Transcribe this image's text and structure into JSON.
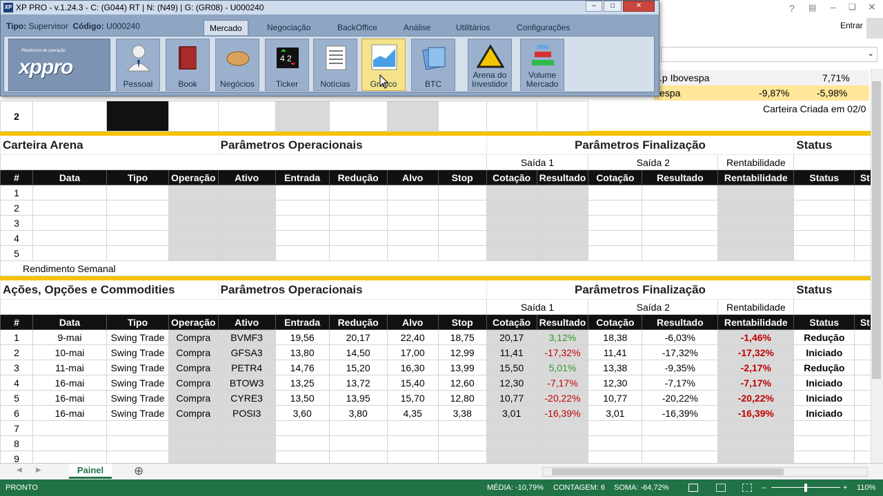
{
  "excel": {
    "signin": "Entrar",
    "sheet_tab": "Painel",
    "add_sheet": "⊕"
  },
  "window": {
    "title": "XP PRO  - v.1.24.3 - C: (G044) RT | N: (N49) | G: (GR08) - U000240",
    "tipo_label": "Tipo:",
    "tipo_value": "Supervisor",
    "codigo_label": "Código:",
    "codigo_value": "U000240",
    "min": "–",
    "max": "□",
    "close": "✕",
    "tabs": [
      "Mercado",
      "Negociação",
      "BackOffice",
      "Análise",
      "Utilitários",
      "Configurações"
    ],
    "brand_tag": "Plataforma de operação",
    "brand_logo": "xppro",
    "buttons": [
      {
        "label": "Pessoal",
        "icon": "person-icon"
      },
      {
        "label": "Book",
        "icon": "book-icon"
      },
      {
        "label": "Negócios",
        "icon": "handshake-icon"
      },
      {
        "label": "Ticker",
        "icon": "ticker-icon"
      },
      {
        "label": "Notícias",
        "icon": "news-icon"
      },
      {
        "label": "Gráfico",
        "icon": "chart-icon"
      },
      {
        "label": "BTC",
        "icon": "btc-icon"
      },
      {
        "label": "Arena do Investidor",
        "icon": "arena-icon"
      },
      {
        "label": "Volume Mercado",
        "icon": "volume-icon"
      }
    ]
  },
  "overlay": {
    "ibov_label": ".p Ibovespa",
    "ibov_value": "7,71%",
    "ibov2_label": "espa",
    "ibov2_a": "-9,87%",
    "ibov2_b": "-5,98%",
    "carteira_criada": "Carteira Criada em 02/0",
    "row2": "2"
  },
  "arena": {
    "title": "Carteira Arena",
    "params": "Parâmetros Operacionais",
    "final": "Parâmetros Finalização",
    "status": "Status",
    "saida1": "Saída 1",
    "saida2": "Saída 2",
    "rent": "Rentabilidade",
    "rows": [
      "1",
      "2",
      "3",
      "4",
      "5"
    ],
    "footer": "Rendimento Semanal"
  },
  "headers": [
    "#",
    "Data",
    "Tipo",
    "Operação",
    "Ativo",
    "Entrada",
    "Redução",
    "Alvo",
    "Stop",
    "Cotação",
    "Resultado",
    "Cotação",
    "Resultado",
    "Rentabilidade",
    "Status",
    "St"
  ],
  "acoes": {
    "title": "Ações, Opções e Commodities",
    "params": "Parâmetros Operacionais",
    "final": "Parâmetros Finalização",
    "status": "Status",
    "saida1": "Saída 1",
    "saida2": "Saída 2",
    "rent": "Rentabilidade",
    "rows": [
      {
        "n": "1",
        "data": "9-mai",
        "tipo": "Swing Trade",
        "op": "Compra",
        "ativo": "BVMF3",
        "entrada": "19,56",
        "reducao": "20,17",
        "alvo": "22,40",
        "stop": "18,75",
        "cot1": "20,17",
        "res1": "3,12%",
        "res1_class": "pos",
        "cot2": "18,38",
        "res2": "-6,03%",
        "rent": "-1,46%",
        "status": "Redução"
      },
      {
        "n": "2",
        "data": "10-mai",
        "tipo": "Swing Trade",
        "op": "Compra",
        "ativo": "GFSA3",
        "entrada": "13,80",
        "reducao": "14,50",
        "alvo": "17,00",
        "stop": "12,99",
        "cot1": "11,41",
        "res1": "-17,32%",
        "res1_class": "neg",
        "cot2": "11,41",
        "res2": "-17,32%",
        "rent": "-17,32%",
        "status": "Iniciado"
      },
      {
        "n": "3",
        "data": "11-mai",
        "tipo": "Swing Trade",
        "op": "Compra",
        "ativo": "PETR4",
        "entrada": "14,76",
        "reducao": "15,20",
        "alvo": "16,30",
        "stop": "13,99",
        "cot1": "15,50",
        "res1": "5,01%",
        "res1_class": "pos",
        "cot2": "13,38",
        "res2": "-9,35%",
        "rent": "-2,17%",
        "status": "Redução"
      },
      {
        "n": "4",
        "data": "16-mai",
        "tipo": "Swing Trade",
        "op": "Compra",
        "ativo": "BTOW3",
        "entrada": "13,25",
        "reducao": "13,72",
        "alvo": "15,40",
        "stop": "12,60",
        "cot1": "12,30",
        "res1": "-7,17%",
        "res1_class": "neg",
        "cot2": "12,30",
        "res2": "-7,17%",
        "rent": "-7,17%",
        "status": "Iniciado"
      },
      {
        "n": "5",
        "data": "16-mai",
        "tipo": "Swing Trade",
        "op": "Compra",
        "ativo": "CYRE3",
        "entrada": "13,50",
        "reducao": "13,95",
        "alvo": "15,70",
        "stop": "12,80",
        "cot1": "10,77",
        "res1": "-20,22%",
        "res1_class": "neg",
        "cot2": "10,77",
        "res2": "-20,22%",
        "rent": "-20,22%",
        "status": "Iniciado"
      },
      {
        "n": "6",
        "data": "16-mai",
        "tipo": "Swing Trade",
        "op": "Compra",
        "ativo": "POSI3",
        "entrada": "3,60",
        "reducao": "3,80",
        "alvo": "4,35",
        "stop": "3,38",
        "cot1": "3,01",
        "res1": "-16,39%",
        "res1_class": "neg",
        "cot2": "3,01",
        "res2": "-16,39%",
        "rent": "-16,39%",
        "status": "Iniciado"
      }
    ],
    "empty_rows": [
      "7",
      "8",
      "9"
    ]
  },
  "status": {
    "ready": "PRONTO",
    "media": "MÉDIA: -10,79%",
    "contagem": "CONTAGEM: 6",
    "soma": "SOMA: -64,72%",
    "zoom": "110%"
  }
}
